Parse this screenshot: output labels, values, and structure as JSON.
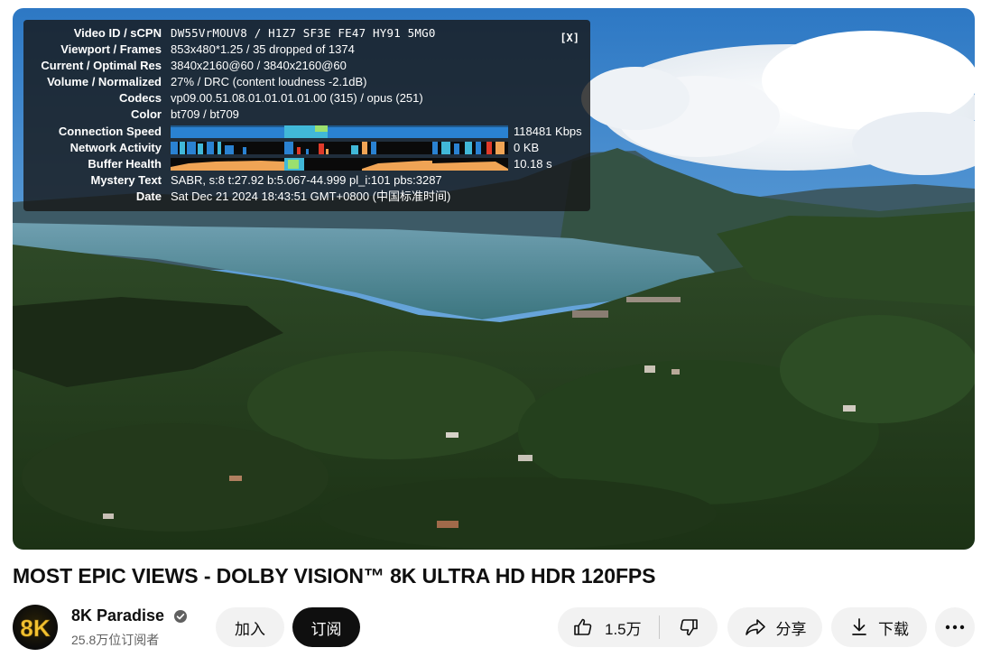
{
  "stats": {
    "close_label": "[X]",
    "rows": [
      {
        "label": "Video ID / sCPN",
        "value": "DW55VrMOUV8 / H1Z7 SF3E FE47 HY91 5MG0"
      },
      {
        "label": "Viewport / Frames",
        "value": "853x480*1.25 / 35 dropped of 1374"
      },
      {
        "label": "Current / Optimal Res",
        "value": "3840x2160@60 / 3840x2160@60"
      },
      {
        "label": "Volume / Normalized",
        "value": "27% / DRC (content loudness -2.1dB)"
      },
      {
        "label": "Codecs",
        "value": "vp09.00.51.08.01.01.01.01.00 (315) / opus (251)"
      },
      {
        "label": "Color",
        "value": "bt709 / bt709"
      },
      {
        "label": "Connection Speed",
        "value": "118481 Kbps"
      },
      {
        "label": "Network Activity",
        "value": "0 KB"
      },
      {
        "label": "Buffer Health",
        "value": "10.18 s"
      },
      {
        "label": "Mystery Text",
        "value": "SABR, s:8 t:27.92 b:5.067-44.999 pl_i:101 pbs:3287"
      },
      {
        "label": "Date",
        "value": "Sat Dec 21 2024 18:43:51 GMT+0800 (中国标准时间)"
      }
    ]
  },
  "video": {
    "title": "MOST EPIC VIEWS - DOLBY VISION™ 8K ULTRA HD HDR 120FPS"
  },
  "channel": {
    "avatar_text": "8K",
    "name": "8K Paradise",
    "subscribers": "25.8万位订阅者",
    "verified_icon": "verified-check-icon"
  },
  "actions": {
    "join_label": "加入",
    "subscribe_label": "订阅",
    "like_count": "1.5万",
    "share_label": "分享",
    "download_label": "下载"
  },
  "colors": {
    "subscribe_bg": "#0f0f0f",
    "pill_bg": "#f2f2f2",
    "graph_blue": "#2a82d2",
    "graph_orange": "#f0a455"
  }
}
